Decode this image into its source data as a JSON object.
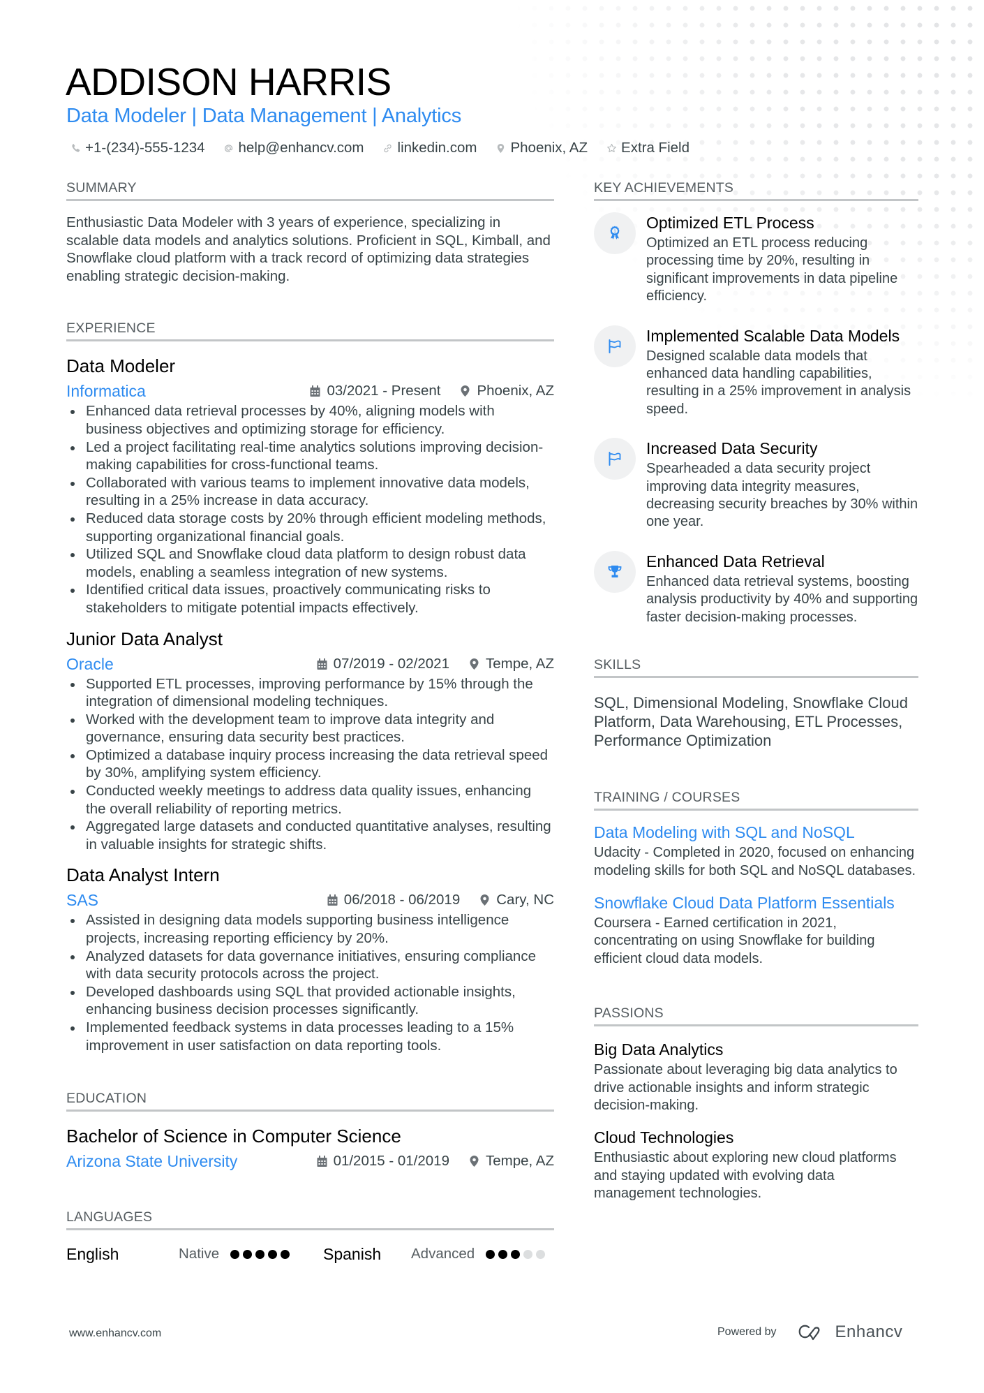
{
  "header": {
    "name": "ADDISON HARRIS",
    "headline": "Data Modeler | Data Management | Analytics",
    "contacts": [
      {
        "icon": "phone-icon",
        "text": "+1-(234)-555-1234"
      },
      {
        "icon": "at-icon",
        "text": "help@enhancv.com"
      },
      {
        "icon": "link-icon",
        "text": "linkedin.com"
      },
      {
        "icon": "location-icon",
        "text": "Phoenix, AZ"
      },
      {
        "icon": "star-icon",
        "text": "Extra Field"
      }
    ]
  },
  "summary": {
    "title": "SUMMARY",
    "text": "Enthusiastic Data Modeler with 3 years of experience, specializing in scalable data models and analytics solutions. Proficient in SQL, Kimball, and Snowflake cloud platform with a track record of optimizing data strategies enabling strategic decision-making."
  },
  "experience": {
    "title": "EXPERIENCE",
    "jobs": [
      {
        "title": "Data Modeler",
        "company": "Informatica",
        "dates": "03/2021 - Present",
        "location": "Phoenix, AZ",
        "bullets": [
          "Enhanced data retrieval processes by 40%, aligning models with business objectives and optimizing storage for efficiency.",
          "Led a project facilitating real-time analytics solutions improving decision-making capabilities for cross-functional teams.",
          "Collaborated with various teams to implement innovative data models, resulting in a 25% increase in data accuracy.",
          "Reduced data storage costs by 20% through efficient modeling methods, supporting organizational financial goals.",
          "Utilized SQL and Snowflake cloud data platform to design robust data models, enabling a seamless integration of new systems.",
          "Identified critical data issues, proactively communicating risks to stakeholders to mitigate potential impacts effectively."
        ]
      },
      {
        "title": "Junior Data Analyst",
        "company": "Oracle",
        "dates": "07/2019 - 02/2021",
        "location": "Tempe, AZ",
        "bullets": [
          "Supported ETL processes, improving performance by 15% through the integration of dimensional modeling techniques.",
          "Worked with the development team to improve data integrity and governance, ensuring data security best practices.",
          "Optimized a database inquiry process increasing the data retrieval speed by 30%, amplifying system efficiency.",
          "Conducted weekly meetings to address data quality issues, enhancing the overall reliability of reporting metrics.",
          "Aggregated large datasets and conducted quantitative analyses, resulting in valuable insights for strategic shifts."
        ]
      },
      {
        "title": "Data Analyst Intern",
        "company": "SAS",
        "dates": "06/2018 - 06/2019",
        "location": "Cary, NC",
        "bullets": [
          "Assisted in designing data models supporting business intelligence projects, increasing reporting efficiency by 20%.",
          "Analyzed datasets for data governance initiatives, ensuring compliance with data security protocols across the project.",
          "Developed dashboards using SQL that provided actionable insights, enhancing business decision processes significantly.",
          "Implemented feedback systems in data processes leading to a 15% improvement in user satisfaction on data reporting tools."
        ]
      }
    ]
  },
  "education": {
    "title": "EDUCATION",
    "degree": "Bachelor of Science in Computer Science",
    "school": "Arizona State University",
    "dates": "01/2015 - 01/2019",
    "location": "Tempe, AZ"
  },
  "languages": {
    "title": "LANGUAGES",
    "items": [
      {
        "name": "English",
        "level": "Native",
        "rating": 5,
        "max": 5
      },
      {
        "name": "Spanish",
        "level": "Advanced",
        "rating": 3,
        "max": 5
      }
    ]
  },
  "achievements": {
    "title": "KEY ACHIEVEMENTS",
    "items": [
      {
        "icon": "award-ribbon-icon",
        "title": "Optimized ETL Process",
        "desc": "Optimized an ETL process reducing processing time by 20%, resulting in significant improvements in data pipeline efficiency."
      },
      {
        "icon": "flag-icon",
        "title": "Implemented Scalable Data Models",
        "desc": "Designed scalable data models that enhanced data handling capabilities, resulting in a 25% improvement in analysis speed."
      },
      {
        "icon": "flag-icon",
        "title": "Increased Data Security",
        "desc": "Spearheaded a data security project improving data integrity measures, decreasing security breaches by 30% within one year."
      },
      {
        "icon": "trophy-icon",
        "title": "Enhanced Data Retrieval",
        "desc": "Enhanced data retrieval systems, boosting analysis productivity by 40% and supporting faster decision-making processes."
      }
    ]
  },
  "skills": {
    "title": "SKILLS",
    "text": "SQL, Dimensional Modeling, Snowflake Cloud Platform, Data Warehousing, ETL Processes, Performance Optimization"
  },
  "training": {
    "title": "TRAINING / COURSES",
    "items": [
      {
        "title": "Data Modeling with SQL and NoSQL",
        "desc": "Udacity - Completed in 2020, focused on enhancing modeling skills for both SQL and NoSQL databases."
      },
      {
        "title": "Snowflake Cloud Data Platform Essentials",
        "desc": "Coursera - Earned certification in 2021, concentrating on using Snowflake for building efficient cloud data models."
      }
    ]
  },
  "passions": {
    "title": "PASSIONS",
    "items": [
      {
        "title": "Big Data Analytics",
        "desc": "Passionate about leveraging big data analytics to drive actionable insights and inform strategic decision-making."
      },
      {
        "title": "Cloud Technologies",
        "desc": "Enthusiastic about exploring new cloud platforms and staying updated with evolving data management technologies."
      }
    ]
  },
  "footer": {
    "website": "www.enhancv.com",
    "powered_by": "Powered by",
    "brand": "Enhancv"
  },
  "colors": {
    "accent": "#2e8bf0",
    "text": "#384347",
    "rule": "#c2c5c7"
  }
}
